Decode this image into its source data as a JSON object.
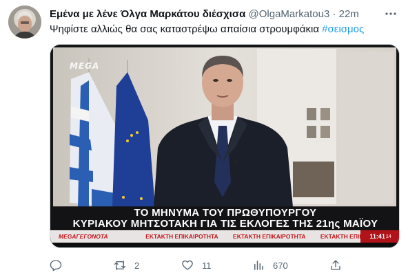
{
  "tweet": {
    "display_name": "Εμένα με λένε Όλγα Μαρκάτου διέσχισα",
    "handle": "@OlgaMarkatou3",
    "separator": "·",
    "time": "22m",
    "more_icon": "more-dots-icon",
    "text": "Ψηφίστε αλλιώς θα σας καταστρέψω απαίσια στρουμφάκια ",
    "hashtag": "#σεισμος"
  },
  "media": {
    "channel_logo": "MEGA",
    "caption_line1": "ΤΟ ΜΗΝΥΜΑ ΤΟΥ ΠΡΩΘΥΠΟΥΡΓΟΥ",
    "caption_line2": "ΚΥΡΙΑΚΟΥ ΜΗΤΣΟΤΑΚΗ ΓΙΑ ΤΙΣ ΕΚΛΟΓΕΣ ΤΗΣ 21ης ΜΑΪΟΥ",
    "ticker_brand_mega": "MEGA",
    "ticker_brand_rest": "ΓΕΓΟΝΟΤΑ",
    "ticker_item_1": "ΕΚΤΑΚΤΗ ΕΠΙΚΑΙΡΟΤΗΤΑ",
    "ticker_item_2": "ΕΚΤΑΚΤΗ ΕΠΙΚΑΙΡΟΤΗΤΑ",
    "ticker_item_3": "ΕΚΤΑΚΤΗ ΕΠΙΚΑΙΡΟΤΗΤΑ",
    "clock_time": "11:41",
    "clock_seconds": "14"
  },
  "actions": {
    "reply_count": "",
    "retweet_count": "2",
    "like_count": "11",
    "views_count": "670",
    "share_count": ""
  },
  "colors": {
    "accent": "#1d9bf0",
    "secondary_text": "#536471",
    "ticker_red": "#c4161c"
  }
}
